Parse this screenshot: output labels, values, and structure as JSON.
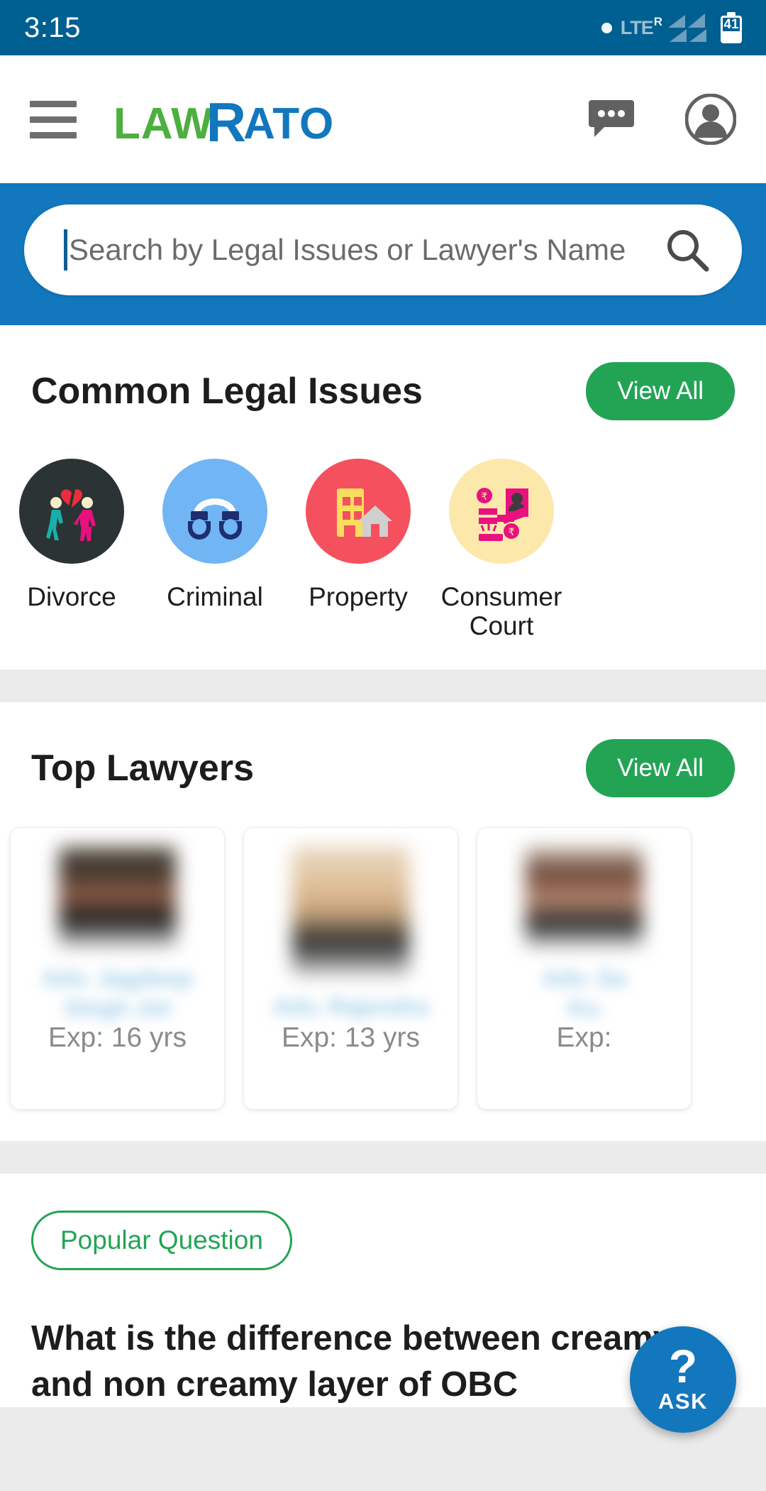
{
  "status_bar": {
    "time": "3:15",
    "network_label": "LTE",
    "roaming_label": "R",
    "battery_level": "41"
  },
  "app_bar": {
    "menu_icon": "hamburger-menu-icon",
    "logo": {
      "part1": "LAW",
      "part2": "R",
      "part3": "ATO"
    },
    "chat_icon": "chat-bubble-icon",
    "account_icon": "account-circle-icon"
  },
  "search": {
    "placeholder": "Search by Legal Issues or Lawyer's Name",
    "icon": "search-icon"
  },
  "common_issues": {
    "title": "Common Legal Issues",
    "view_all_label": "View All",
    "items": [
      {
        "label": "Divorce",
        "icon": "divorce-couple-icon",
        "bg": "#2b3335"
      },
      {
        "label": "Criminal",
        "icon": "handcuffs-icon",
        "bg": "#72b5f4"
      },
      {
        "label": "Property",
        "icon": "building-house-icon",
        "bg": "#f4505e"
      },
      {
        "label": "Consumer Court",
        "icon": "consumer-court-icon",
        "bg": "#fce8ab"
      }
    ]
  },
  "top_lawyers": {
    "title": "Top Lawyers",
    "view_all_label": "View All",
    "cards": [
      {
        "experience": "Exp: 16 yrs"
      },
      {
        "experience": "Exp: 13 yrs"
      },
      {
        "experience": "Exp:"
      }
    ]
  },
  "popular_question": {
    "badge": "Popular Question",
    "line1": "What is the difference between creamy",
    "line2": "and non creamy layer of OBC"
  },
  "fab": {
    "question_mark": "?",
    "label": "ASK"
  },
  "colors": {
    "status_bar": "#005f91",
    "primary_blue": "#1277bd",
    "accent_green": "#23a455",
    "logo_green": "#4caf3f"
  }
}
